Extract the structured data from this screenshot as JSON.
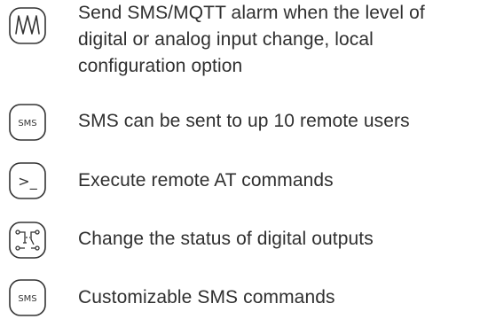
{
  "features": [
    {
      "icon": "waveform-icon",
      "text": "Send SMS/MQTT alarm when the level of digital or analog input change, local configuration option"
    },
    {
      "icon": "sms-icon",
      "icon_label": "SMS",
      "text": "SMS can be sent to up 10 remote users"
    },
    {
      "icon": "terminal-icon",
      "icon_label": ">_",
      "text": "Execute remote AT commands"
    },
    {
      "icon": "digital-output-icon",
      "text": "Change the status of digital outputs"
    },
    {
      "icon": "sms-icon",
      "icon_label": "SMS",
      "text": "Customizable SMS commands"
    }
  ]
}
